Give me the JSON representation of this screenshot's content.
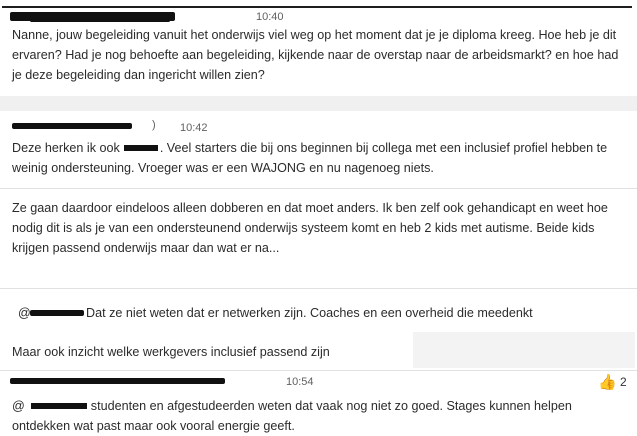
{
  "messages": [
    {
      "time": "10:40",
      "text": "Nanne, jouw begeleiding vanuit het onderwijs viel weg op het moment dat je je diploma kreeg. Hoe heb je dit ervaren? Had je nog behoefte aan begeleiding, kijkende naar de overstap naar de arbeidsmarkt? en hoe had je deze begeleiding dan ingericht willen zien?"
    },
    {
      "time": "10:42",
      "prefix": "Deze herken ik ook",
      "text": ". Veel starters die bij ons beginnen bij collega met een inclusief profiel hebben te weinig ondersteuning. Vroeger was er een WAJONG en nu nagenoeg niets.",
      "followups": [
        "Ze gaan daardoor eindeloos alleen dobberen en dat moet anders. Ik ben zelf ook gehandicapt en weet hoe nodig dit is als je van een ondersteunend onderwijs systeem komt en heb 2 kids met autisme. Beide kids krijgen passend onderwijs maar dan wat er na...",
        "@",
        "Dat ze niet weten dat er netwerken zijn. Coaches en een overheid die meedenkt",
        "Maar ook inzicht welke werkgevers inclusief passend zijn"
      ]
    },
    {
      "time": "10:54",
      "mention": "@",
      "text": "studenten en afgestudeerden weten dat vaak nog niet zo goed. Stages kunnen helpen ontdekken wat past maar ook vooral energie geeft.",
      "reaction": {
        "icon": "thumbs-up-icon",
        "emoji": "👍",
        "count": "2"
      }
    }
  ]
}
